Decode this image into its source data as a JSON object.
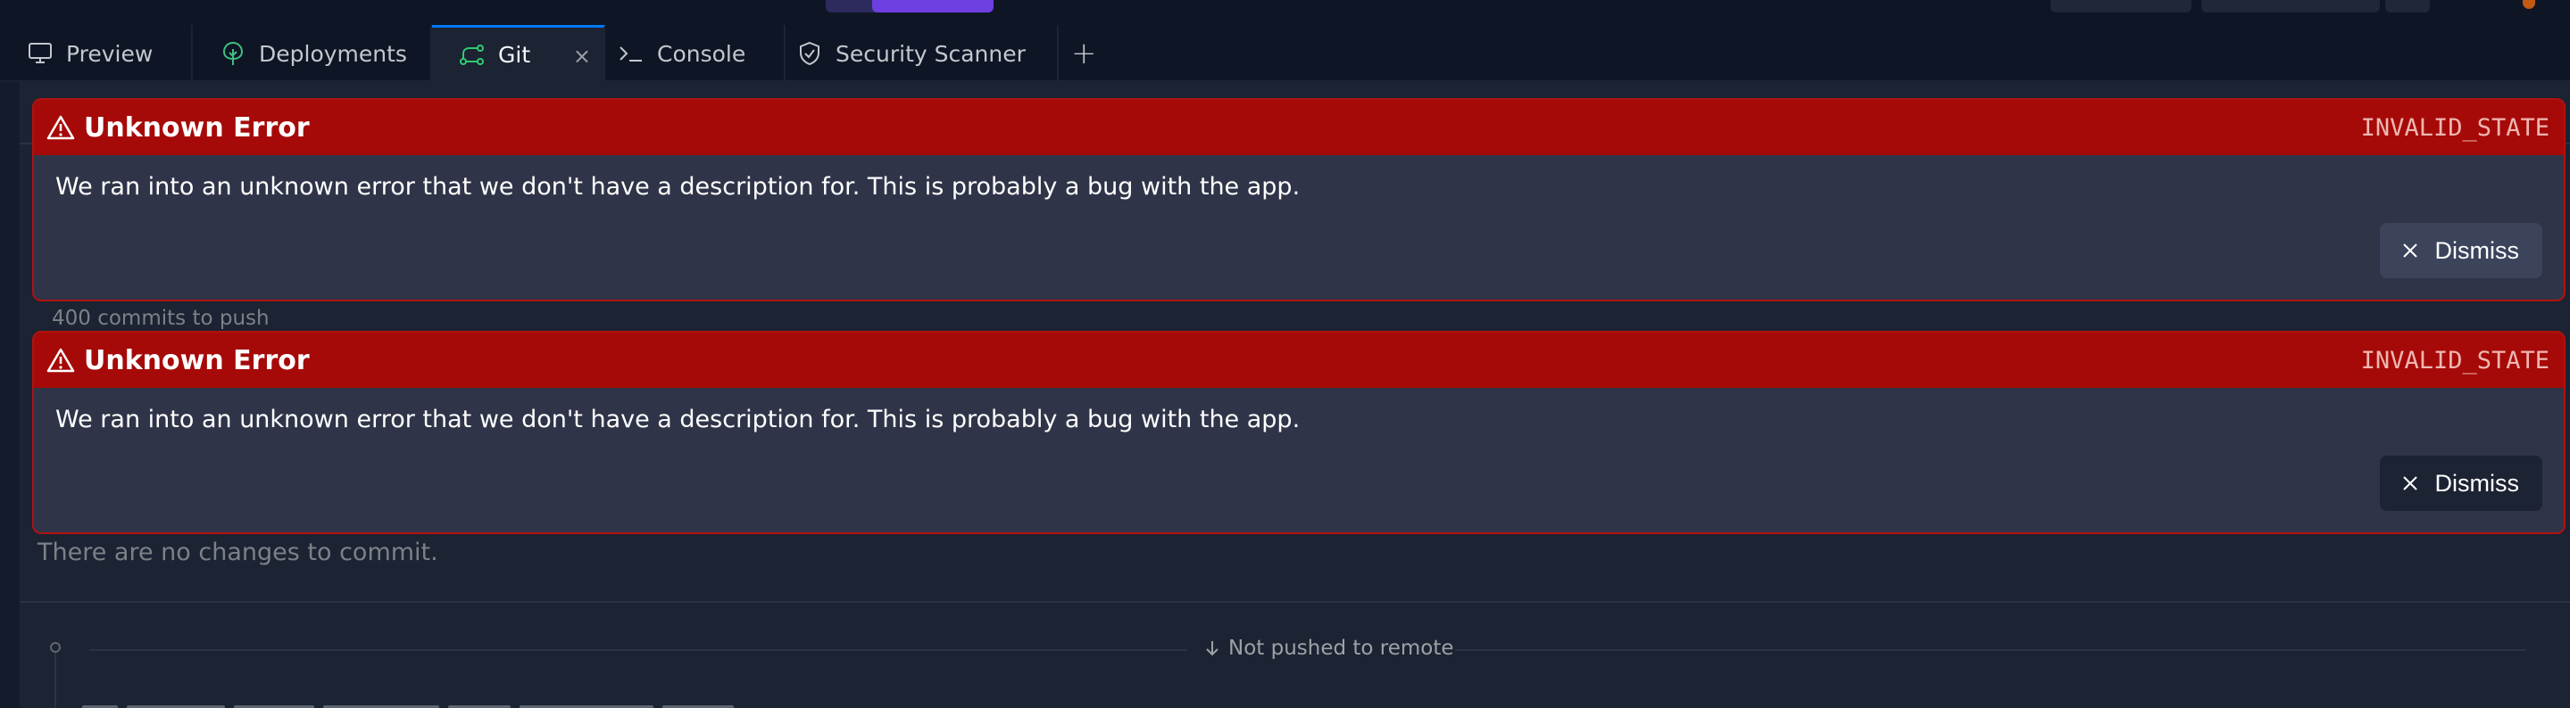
{
  "tabs": [
    {
      "label": "Preview",
      "icon": "monitor-icon"
    },
    {
      "label": "Deployments",
      "icon": "deployments-icon"
    },
    {
      "label": "Git",
      "icon": "git-branch-icon",
      "active": true,
      "close": "×"
    },
    {
      "label": "Console",
      "icon": "terminal-icon"
    },
    {
      "label": "Security Scanner",
      "icon": "shield-icon"
    }
  ],
  "add_tab_label": "+",
  "git": {
    "commits_to_push": "400 commits to push",
    "no_changes": "There are no changes to commit.",
    "not_pushed": "Not pushed to remote"
  },
  "errors": [
    {
      "title": "Unknown Error",
      "code": "INVALID_STATE",
      "message": "We ran into an unknown error that we don't have a description for. This is probably a bug with the app.",
      "dismiss_label": "Dismiss"
    },
    {
      "title": "Unknown Error",
      "code": "INVALID_STATE",
      "message": "We ran into an unknown error that we don't have a description for. This is probably a bug with the app.",
      "dismiss_label": "Dismiss"
    }
  ],
  "colors": {
    "error_header": "#a60a08",
    "error_border": "#b1120f",
    "active_tab_accent": "#0079f2",
    "git_icon": "#2ecc71"
  }
}
